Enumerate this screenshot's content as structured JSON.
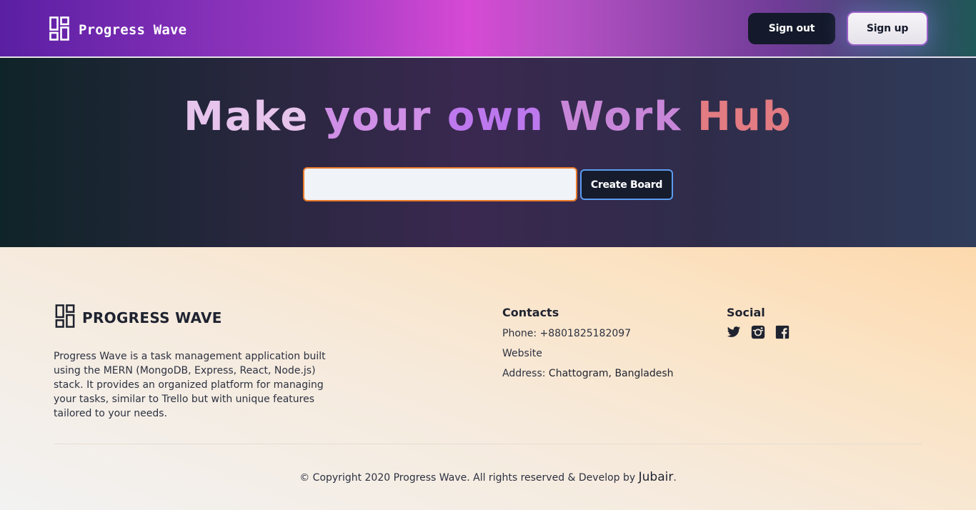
{
  "header": {
    "brand_name": "Progress Wave",
    "logo_icon": "dashboard-grid-icon",
    "signout_label": "Sign out",
    "signup_label": "Sign up"
  },
  "hero": {
    "title_words": [
      "Make",
      "your",
      "own",
      "Work",
      "Hub"
    ],
    "board_input_value": "",
    "create_board_label": "Create Board"
  },
  "footer": {
    "brand_name": "PROGRESS WAVE",
    "description": "Progress Wave is a task management application built using the MERN (MongoDB, Express, React, Node.js) stack. It provides an organized platform for managing your tasks, similar to Trello but with unique features tailored to your needs.",
    "contacts": {
      "heading": "Contacts",
      "phone_label": "Phone: ",
      "phone": "+8801825182097",
      "website": "Website",
      "address_label": "Address: ",
      "address": "Chattogram, Bangladesh"
    },
    "social": {
      "heading": "Social",
      "icons": [
        "twitter-icon",
        "instagram-icon",
        "facebook-icon"
      ]
    },
    "copyright": "© Copyright 2020 Progress Wave. All rights reserved & Develop by ",
    "author": "Jubair",
    "copyright_end": "."
  },
  "colors": {
    "accent_orange": "#ea7a2a",
    "button_dark": "#141a2b",
    "focus_blue": "#5b9cf0"
  }
}
